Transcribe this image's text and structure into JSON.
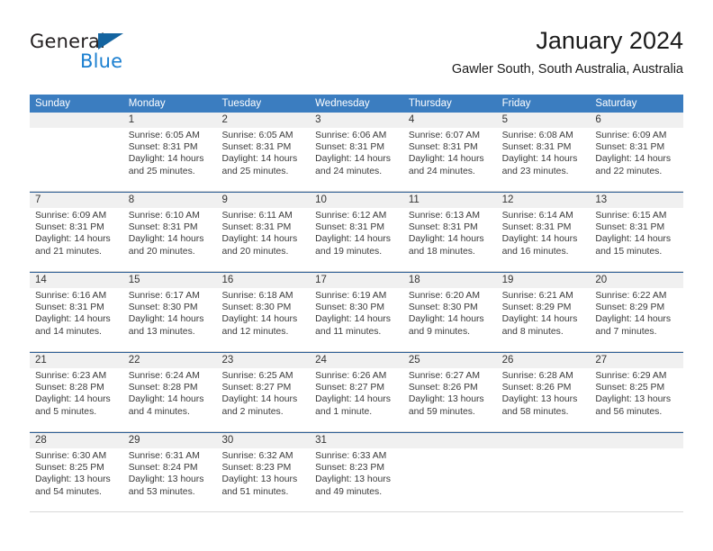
{
  "brand": {
    "name_top": "General",
    "name_bottom": "Blue",
    "triangle_icon": "triangle-icon",
    "color_dark": "#231f20",
    "color_blue": "#1b7fd0"
  },
  "header": {
    "month_title": "January 2024",
    "location": "Gawler South, South Australia, Australia"
  },
  "calendar": {
    "header_bg": "#3b7dc0",
    "daynum_bg": "#f0f0f0",
    "weekday_labels": [
      "Sunday",
      "Monday",
      "Tuesday",
      "Wednesday",
      "Thursday",
      "Friday",
      "Saturday"
    ],
    "weeks": [
      [
        {
          "day": "",
          "sunrise": "",
          "sunset": "",
          "daylight1": "",
          "daylight2": ""
        },
        {
          "day": "1",
          "sunrise": "Sunrise: 6:05 AM",
          "sunset": "Sunset: 8:31 PM",
          "daylight1": "Daylight: 14 hours",
          "daylight2": "and 25 minutes."
        },
        {
          "day": "2",
          "sunrise": "Sunrise: 6:05 AM",
          "sunset": "Sunset: 8:31 PM",
          "daylight1": "Daylight: 14 hours",
          "daylight2": "and 25 minutes."
        },
        {
          "day": "3",
          "sunrise": "Sunrise: 6:06 AM",
          "sunset": "Sunset: 8:31 PM",
          "daylight1": "Daylight: 14 hours",
          "daylight2": "and 24 minutes."
        },
        {
          "day": "4",
          "sunrise": "Sunrise: 6:07 AM",
          "sunset": "Sunset: 8:31 PM",
          "daylight1": "Daylight: 14 hours",
          "daylight2": "and 24 minutes."
        },
        {
          "day": "5",
          "sunrise": "Sunrise: 6:08 AM",
          "sunset": "Sunset: 8:31 PM",
          "daylight1": "Daylight: 14 hours",
          "daylight2": "and 23 minutes."
        },
        {
          "day": "6",
          "sunrise": "Sunrise: 6:09 AM",
          "sunset": "Sunset: 8:31 PM",
          "daylight1": "Daylight: 14 hours",
          "daylight2": "and 22 minutes."
        }
      ],
      [
        {
          "day": "7",
          "sunrise": "Sunrise: 6:09 AM",
          "sunset": "Sunset: 8:31 PM",
          "daylight1": "Daylight: 14 hours",
          "daylight2": "and 21 minutes."
        },
        {
          "day": "8",
          "sunrise": "Sunrise: 6:10 AM",
          "sunset": "Sunset: 8:31 PM",
          "daylight1": "Daylight: 14 hours",
          "daylight2": "and 20 minutes."
        },
        {
          "day": "9",
          "sunrise": "Sunrise: 6:11 AM",
          "sunset": "Sunset: 8:31 PM",
          "daylight1": "Daylight: 14 hours",
          "daylight2": "and 20 minutes."
        },
        {
          "day": "10",
          "sunrise": "Sunrise: 6:12 AM",
          "sunset": "Sunset: 8:31 PM",
          "daylight1": "Daylight: 14 hours",
          "daylight2": "and 19 minutes."
        },
        {
          "day": "11",
          "sunrise": "Sunrise: 6:13 AM",
          "sunset": "Sunset: 8:31 PM",
          "daylight1": "Daylight: 14 hours",
          "daylight2": "and 18 minutes."
        },
        {
          "day": "12",
          "sunrise": "Sunrise: 6:14 AM",
          "sunset": "Sunset: 8:31 PM",
          "daylight1": "Daylight: 14 hours",
          "daylight2": "and 16 minutes."
        },
        {
          "day": "13",
          "sunrise": "Sunrise: 6:15 AM",
          "sunset": "Sunset: 8:31 PM",
          "daylight1": "Daylight: 14 hours",
          "daylight2": "and 15 minutes."
        }
      ],
      [
        {
          "day": "14",
          "sunrise": "Sunrise: 6:16 AM",
          "sunset": "Sunset: 8:31 PM",
          "daylight1": "Daylight: 14 hours",
          "daylight2": "and 14 minutes."
        },
        {
          "day": "15",
          "sunrise": "Sunrise: 6:17 AM",
          "sunset": "Sunset: 8:30 PM",
          "daylight1": "Daylight: 14 hours",
          "daylight2": "and 13 minutes."
        },
        {
          "day": "16",
          "sunrise": "Sunrise: 6:18 AM",
          "sunset": "Sunset: 8:30 PM",
          "daylight1": "Daylight: 14 hours",
          "daylight2": "and 12 minutes."
        },
        {
          "day": "17",
          "sunrise": "Sunrise: 6:19 AM",
          "sunset": "Sunset: 8:30 PM",
          "daylight1": "Daylight: 14 hours",
          "daylight2": "and 11 minutes."
        },
        {
          "day": "18",
          "sunrise": "Sunrise: 6:20 AM",
          "sunset": "Sunset: 8:30 PM",
          "daylight1": "Daylight: 14 hours",
          "daylight2": "and 9 minutes."
        },
        {
          "day": "19",
          "sunrise": "Sunrise: 6:21 AM",
          "sunset": "Sunset: 8:29 PM",
          "daylight1": "Daylight: 14 hours",
          "daylight2": "and 8 minutes."
        },
        {
          "day": "20",
          "sunrise": "Sunrise: 6:22 AM",
          "sunset": "Sunset: 8:29 PM",
          "daylight1": "Daylight: 14 hours",
          "daylight2": "and 7 minutes."
        }
      ],
      [
        {
          "day": "21",
          "sunrise": "Sunrise: 6:23 AM",
          "sunset": "Sunset: 8:28 PM",
          "daylight1": "Daylight: 14 hours",
          "daylight2": "and 5 minutes."
        },
        {
          "day": "22",
          "sunrise": "Sunrise: 6:24 AM",
          "sunset": "Sunset: 8:28 PM",
          "daylight1": "Daylight: 14 hours",
          "daylight2": "and 4 minutes."
        },
        {
          "day": "23",
          "sunrise": "Sunrise: 6:25 AM",
          "sunset": "Sunset: 8:27 PM",
          "daylight1": "Daylight: 14 hours",
          "daylight2": "and 2 minutes."
        },
        {
          "day": "24",
          "sunrise": "Sunrise: 6:26 AM",
          "sunset": "Sunset: 8:27 PM",
          "daylight1": "Daylight: 14 hours",
          "daylight2": "and 1 minute."
        },
        {
          "day": "25",
          "sunrise": "Sunrise: 6:27 AM",
          "sunset": "Sunset: 8:26 PM",
          "daylight1": "Daylight: 13 hours",
          "daylight2": "and 59 minutes."
        },
        {
          "day": "26",
          "sunrise": "Sunrise: 6:28 AM",
          "sunset": "Sunset: 8:26 PM",
          "daylight1": "Daylight: 13 hours",
          "daylight2": "and 58 minutes."
        },
        {
          "day": "27",
          "sunrise": "Sunrise: 6:29 AM",
          "sunset": "Sunset: 8:25 PM",
          "daylight1": "Daylight: 13 hours",
          "daylight2": "and 56 minutes."
        }
      ],
      [
        {
          "day": "28",
          "sunrise": "Sunrise: 6:30 AM",
          "sunset": "Sunset: 8:25 PM",
          "daylight1": "Daylight: 13 hours",
          "daylight2": "and 54 minutes."
        },
        {
          "day": "29",
          "sunrise": "Sunrise: 6:31 AM",
          "sunset": "Sunset: 8:24 PM",
          "daylight1": "Daylight: 13 hours",
          "daylight2": "and 53 minutes."
        },
        {
          "day": "30",
          "sunrise": "Sunrise: 6:32 AM",
          "sunset": "Sunset: 8:23 PM",
          "daylight1": "Daylight: 13 hours",
          "daylight2": "and 51 minutes."
        },
        {
          "day": "31",
          "sunrise": "Sunrise: 6:33 AM",
          "sunset": "Sunset: 8:23 PM",
          "daylight1": "Daylight: 13 hours",
          "daylight2": "and 49 minutes."
        },
        {
          "day": "",
          "sunrise": "",
          "sunset": "",
          "daylight1": "",
          "daylight2": ""
        },
        {
          "day": "",
          "sunrise": "",
          "sunset": "",
          "daylight1": "",
          "daylight2": ""
        },
        {
          "day": "",
          "sunrise": "",
          "sunset": "",
          "daylight1": "",
          "daylight2": ""
        }
      ]
    ]
  }
}
